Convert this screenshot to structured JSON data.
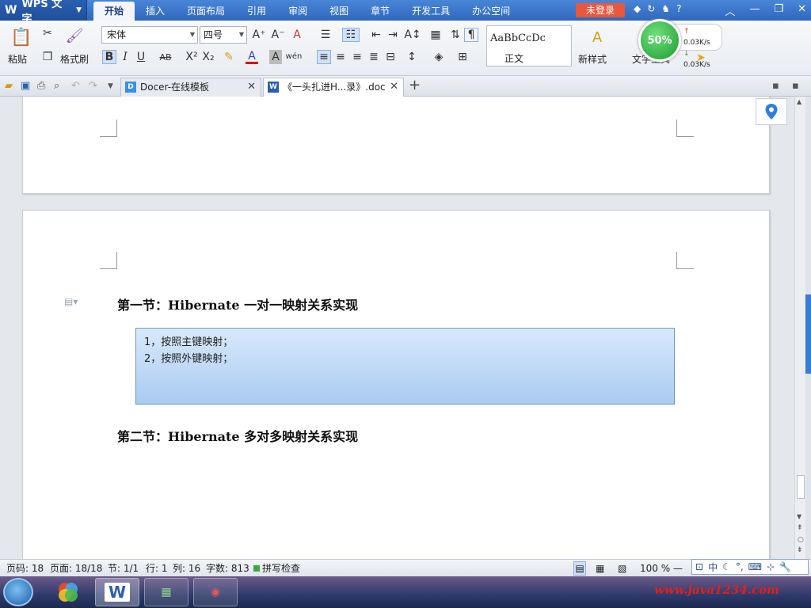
{
  "app": {
    "name": "WPS 文字"
  },
  "menu": [
    "开始",
    "插入",
    "页面布局",
    "引用",
    "审阅",
    "视图",
    "章节",
    "开发工具",
    "办公空间"
  ],
  "login_label": "未登录",
  "ribbon": {
    "paste": "粘贴",
    "format_painter": "格式刷",
    "font_name": "宋体",
    "font_size": "四号",
    "style_sample": "AaBbCcDc",
    "style_name": "正文",
    "new_style": "新样式",
    "text_tool": "文字工具"
  },
  "speed": {
    "percent": "50%",
    "up": "0.03K/s",
    "down": "0.03K/s"
  },
  "doctabs": [
    {
      "label": "Docer-在线模板",
      "active": false
    },
    {
      "label": "《一头扎进H...录》.doc",
      "active": true
    }
  ],
  "document": {
    "section1_title": "第一节：Hibernate 一对一映射关系实现",
    "box_items": [
      "1，按照主键映射；",
      "2，按照外键映射；"
    ],
    "section2_title": "第二节：Hibernate 多对多映射关系实现"
  },
  "status": {
    "page_code": "页码: 18",
    "pages": "页面: 18/18",
    "section": "节: 1/1",
    "row": "行: 1",
    "col": "列: 16",
    "word_count": "字数: 813",
    "spell_check": "拼写检查",
    "zoom": "100 %"
  },
  "ime": {
    "lang": "中"
  },
  "watermark": "www.java1234.com",
  "colors": {
    "accent": "#2f67bd",
    "login": "#e8583e",
    "highlight_box": "#a9cbf1"
  }
}
